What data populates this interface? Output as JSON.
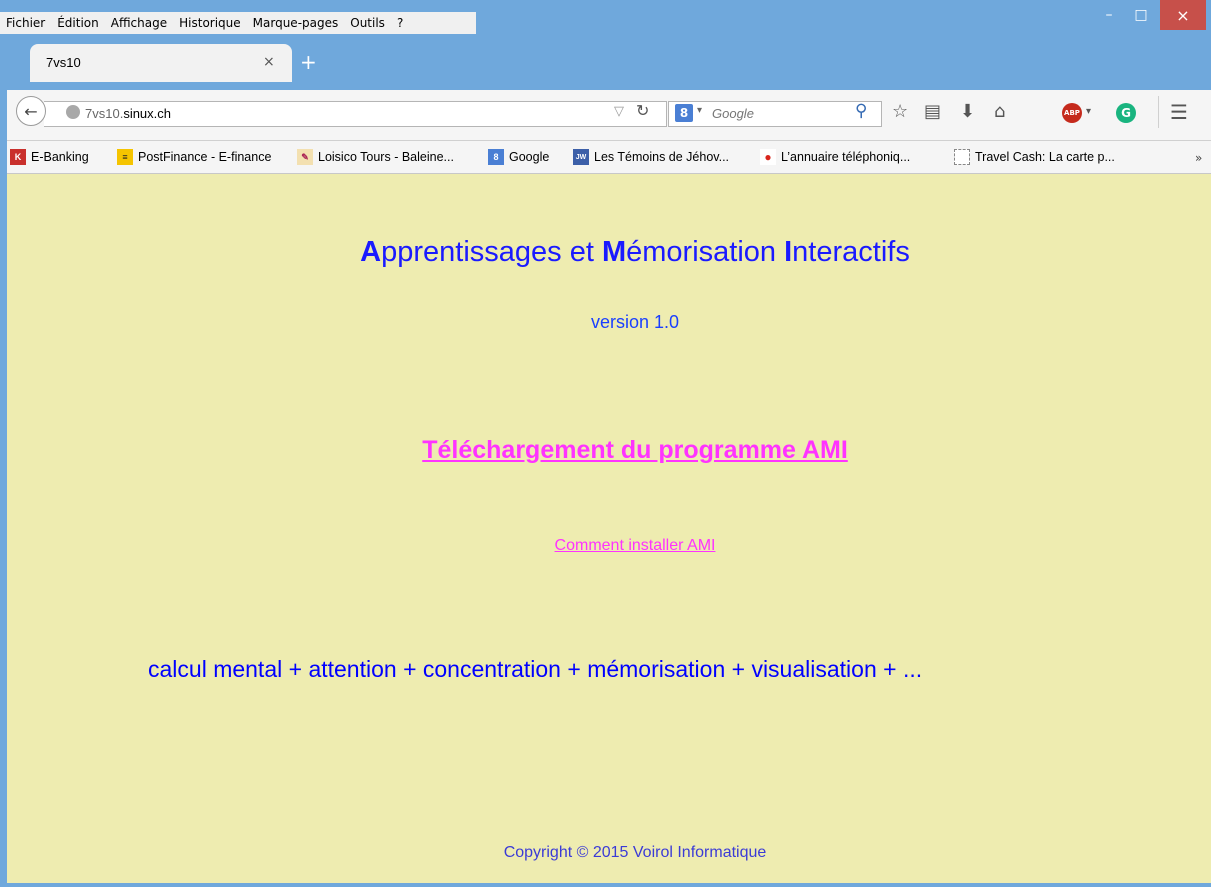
{
  "menu": {
    "items": [
      "Fichier",
      "Édition",
      "Affichage",
      "Historique",
      "Marque-pages",
      "Outils",
      "?"
    ]
  },
  "window_controls": {
    "minimize": "–",
    "maximize": "□",
    "close": "×"
  },
  "tabs": [
    {
      "label": "7vs10",
      "close": "×"
    }
  ],
  "new_tab_label": "+",
  "navigation": {
    "url_domain_prefix": "7vs10.",
    "url_domain_main": "sinux.ch",
    "search_engine_icon": "8",
    "search_placeholder": "Google"
  },
  "bookmarks": [
    {
      "label": "E-Banking",
      "icon_color": "#c9302c",
      "icon_glyph": "K"
    },
    {
      "label": "PostFinance - E-finance",
      "icon_color": "#f5c400",
      "icon_glyph": "≡"
    },
    {
      "label": "Loisico Tours - Baleine...",
      "icon_color": "#e8c470",
      "icon_glyph": "✎"
    },
    {
      "label": "Google",
      "icon_color": "#4a7fd4",
      "icon_glyph": "8"
    },
    {
      "label": "Les Témoins de Jéhov...",
      "icon_color": "#3c5fa8",
      "icon_glyph": "JW"
    },
    {
      "label": "L’annuaire téléphoniq...",
      "icon_color": "#d9251c",
      "icon_glyph": "●"
    },
    {
      "label": "Travel Cash: La carte p...",
      "icon_color": "#ffffff",
      "icon_glyph": ""
    }
  ],
  "bookmarks_overflow": "»",
  "page": {
    "title_parts": [
      "A",
      "pprentissages et ",
      "M",
      "émorisation ",
      "I",
      "nteractifs"
    ],
    "version": "version 1.0",
    "download_link": "Téléchargement du programme AMI",
    "install_link": "Comment installer AMI",
    "tagline": "calcul mental + attention + concentration + mémorisation + visualisation + ...",
    "copyright": "Copyright © 2015 Voirol Informatique"
  },
  "colors": {
    "page_background": "#eeecb0",
    "title_blue": "#1a1aff",
    "link_pink": "#ff33ff",
    "window_frame": "#6fa8dc",
    "close_button": "#c7504a"
  }
}
